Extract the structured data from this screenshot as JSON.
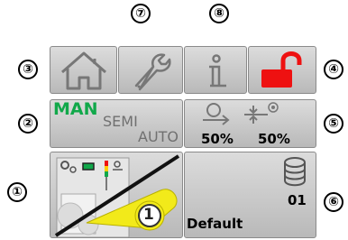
{
  "markers": [
    "①",
    "②",
    "③",
    "④",
    "⑤",
    "⑥",
    "⑦",
    "⑧"
  ],
  "modes": {
    "man": "MAN",
    "semi": "SEMI",
    "auto": "AUTO"
  },
  "speed": {
    "left_value": "50%",
    "right_value": "50%"
  },
  "recipe": {
    "number": "01",
    "name": "Default"
  },
  "mini_display": {
    "counter_digit": "1"
  },
  "colors": {
    "accent_green": "#11a84a",
    "lock_red": "#ee1111",
    "yellow": "#f2ea1a",
    "button_gray": "#c8c8c8"
  },
  "icons": {
    "home": "home-icon",
    "wrench": "wrench-icon",
    "info": "info-icon",
    "lock": "unlock-icon",
    "database": "database-icon",
    "speed": "speed-icon"
  }
}
